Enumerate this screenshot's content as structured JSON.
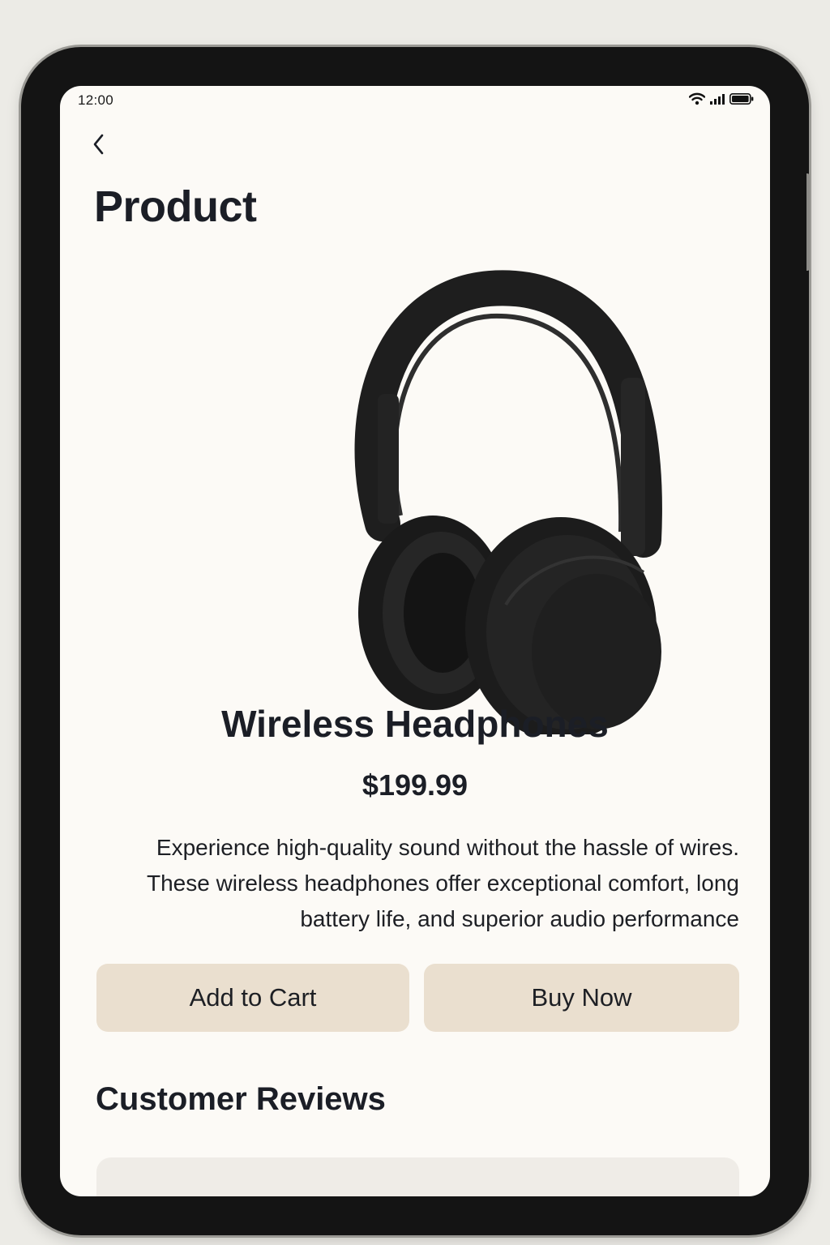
{
  "status_bar": {
    "time": "12:00",
    "icons": [
      "wifi-icon",
      "signal-icon",
      "battery-icon"
    ]
  },
  "header": {
    "back_icon": "chevron-left-icon",
    "title": "Product"
  },
  "product": {
    "image": "headphones-image",
    "name": "Wireless Headphones",
    "price": "$199.99",
    "description": "Experience high-quality sound without the hassle of wires. These wireless headphones offer exceptional comfort, long battery life, and superior audio performance"
  },
  "actions": {
    "add_to_cart": "Add to Cart",
    "buy_now": "Buy Now"
  },
  "reviews": {
    "title": "Customer Reviews"
  },
  "colors": {
    "background": "#fcfaf6",
    "button": "#eadfcf",
    "text": "#1b1e26",
    "device_frame": "#141414"
  }
}
